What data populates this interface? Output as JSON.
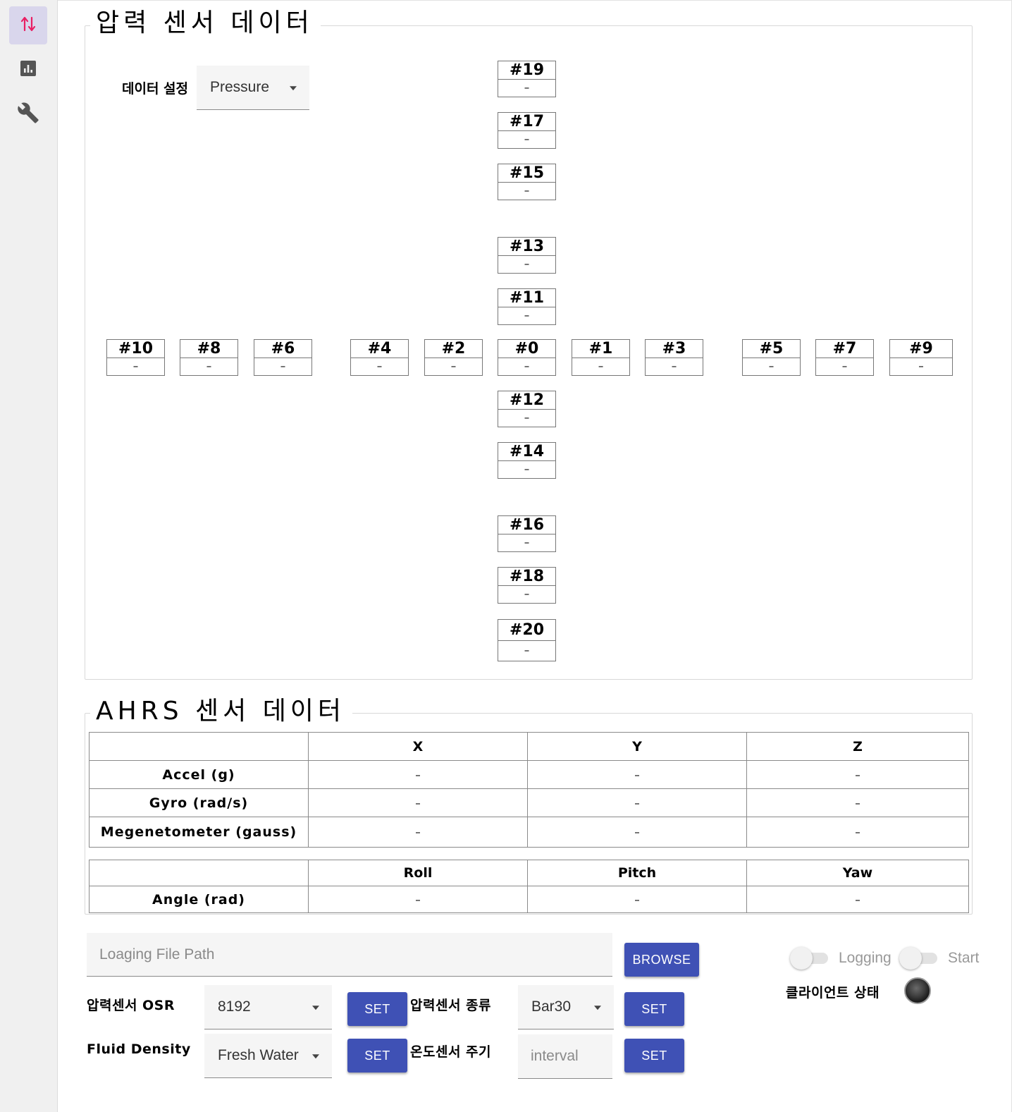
{
  "sidebar": {
    "items": [
      {
        "name": "transfer-icon",
        "active": true
      },
      {
        "name": "chart-icon",
        "active": false
      },
      {
        "name": "wrench-icon",
        "active": false
      }
    ],
    "accent_color": "#e91e63"
  },
  "pressure": {
    "title": "압력 센서 데이터",
    "data_setting_label": "데이터 설정",
    "data_setting_value": "Pressure",
    "sensors": {
      "s19": {
        "label": "#19",
        "value": "–"
      },
      "s17": {
        "label": "#17",
        "value": "–"
      },
      "s15": {
        "label": "#15",
        "value": "–"
      },
      "s13": {
        "label": "#13",
        "value": "–"
      },
      "s11": {
        "label": "#11",
        "value": "–"
      },
      "s10": {
        "label": "#10",
        "value": "–"
      },
      "s8": {
        "label": "#8",
        "value": "–"
      },
      "s6": {
        "label": "#6",
        "value": "–"
      },
      "s4": {
        "label": "#4",
        "value": "–"
      },
      "s2": {
        "label": "#2",
        "value": "–"
      },
      "s0": {
        "label": "#0",
        "value": "–"
      },
      "s1": {
        "label": "#1",
        "value": "–"
      },
      "s3": {
        "label": "#3",
        "value": "–"
      },
      "s5": {
        "label": "#5",
        "value": "–"
      },
      "s7": {
        "label": "#7",
        "value": "–"
      },
      "s9": {
        "label": "#9",
        "value": "–"
      },
      "s12": {
        "label": "#12",
        "value": "–"
      },
      "s14": {
        "label": "#14",
        "value": "–"
      },
      "s16": {
        "label": "#16",
        "value": "–"
      },
      "s18": {
        "label": "#18",
        "value": "–"
      },
      "s20": {
        "label": "#20",
        "value": "–"
      }
    }
  },
  "ahrs": {
    "title": "AHRS 센서 데이터",
    "xyz_headers": [
      "X",
      "Y",
      "Z"
    ],
    "rows": [
      {
        "label": "Accel (g)",
        "values": [
          "–",
          "–",
          "–"
        ]
      },
      {
        "label": "Gyro (rad/s)",
        "values": [
          "–",
          "–",
          "–"
        ]
      },
      {
        "label": "Megenetometer (gauss)",
        "values": [
          "–",
          "–",
          "–"
        ]
      }
    ],
    "angle_headers": [
      "Roll",
      "Pitch",
      "Yaw"
    ],
    "angle_row": {
      "label": "Angle (rad)",
      "values": [
        "–",
        "–",
        "–"
      ]
    }
  },
  "controls": {
    "path_placeholder": "Loaging File Path",
    "browse_label": "BROWSE",
    "osr_label": "압력센서 OSR",
    "osr_value": "8192",
    "osr_set": "SET",
    "sensor_type_label": "압력센서 종류",
    "sensor_type_value": "Bar30",
    "sensor_type_set": "SET",
    "fluid_label": "Fluid Density",
    "fluid_value": "Fresh Water",
    "fluid_set": "SET",
    "temp_label": "온도센서 주기",
    "temp_placeholder": "interval",
    "temp_set": "SET",
    "logging_label": "Logging",
    "start_label": "Start",
    "client_status_label": "클라이언트 상태"
  }
}
